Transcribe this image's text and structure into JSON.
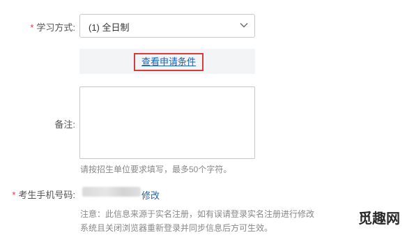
{
  "form": {
    "study_mode": {
      "required_mark": "*",
      "label": "学习方式:",
      "selected_value": "(1) 全日制",
      "icon": "chevron-down-icon"
    },
    "conditions_link": "查看申请条件",
    "remarks": {
      "label": "备注:",
      "hint": "请按招生单位要求填写，最多50个字符。"
    },
    "phone": {
      "required_mark": "*",
      "label": "考生手机号码:",
      "edit_link": "修改"
    },
    "notice_line1": "注意：此信息来源于实名注册，如有误请登录实名注册进行修改",
    "notice_line2": "系统且关闭浏览器重新登录并同步信息后方可生效。"
  },
  "watermark": {
    "text": "觅趣网"
  },
  "colors": {
    "required": "#e4393c",
    "link": "#1a63b0",
    "highlight_border": "#d93a3a",
    "hint_text": "#888888"
  }
}
